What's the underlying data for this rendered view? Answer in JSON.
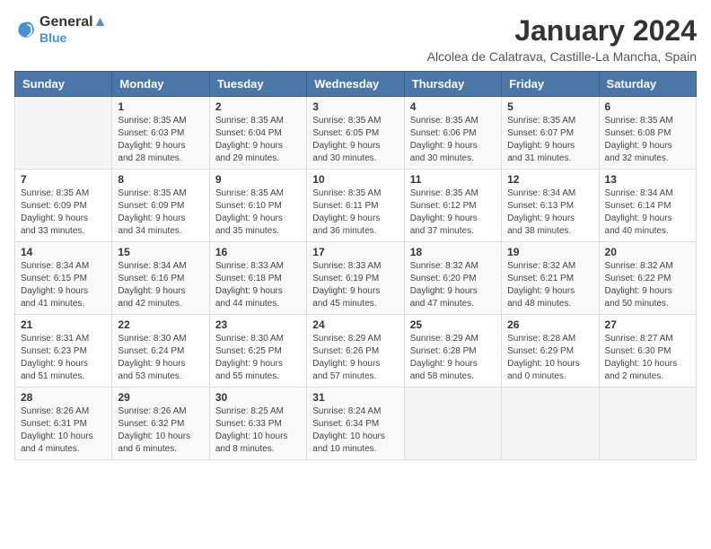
{
  "header": {
    "logo_line1": "General",
    "logo_line2": "Blue",
    "month": "January 2024",
    "location": "Alcolea de Calatrava, Castille-La Mancha, Spain"
  },
  "days_of_week": [
    "Sunday",
    "Monday",
    "Tuesday",
    "Wednesday",
    "Thursday",
    "Friday",
    "Saturday"
  ],
  "weeks": [
    [
      {
        "day": "",
        "info": ""
      },
      {
        "day": "1",
        "info": "Sunrise: 8:35 AM\nSunset: 6:03 PM\nDaylight: 9 hours\nand 28 minutes."
      },
      {
        "day": "2",
        "info": "Sunrise: 8:35 AM\nSunset: 6:04 PM\nDaylight: 9 hours\nand 29 minutes."
      },
      {
        "day": "3",
        "info": "Sunrise: 8:35 AM\nSunset: 6:05 PM\nDaylight: 9 hours\nand 30 minutes."
      },
      {
        "day": "4",
        "info": "Sunrise: 8:35 AM\nSunset: 6:06 PM\nDaylight: 9 hours\nand 30 minutes."
      },
      {
        "day": "5",
        "info": "Sunrise: 8:35 AM\nSunset: 6:07 PM\nDaylight: 9 hours\nand 31 minutes."
      },
      {
        "day": "6",
        "info": "Sunrise: 8:35 AM\nSunset: 6:08 PM\nDaylight: 9 hours\nand 32 minutes."
      }
    ],
    [
      {
        "day": "7",
        "info": "Sunrise: 8:35 AM\nSunset: 6:09 PM\nDaylight: 9 hours\nand 33 minutes."
      },
      {
        "day": "8",
        "info": "Sunrise: 8:35 AM\nSunset: 6:09 PM\nDaylight: 9 hours\nand 34 minutes."
      },
      {
        "day": "9",
        "info": "Sunrise: 8:35 AM\nSunset: 6:10 PM\nDaylight: 9 hours\nand 35 minutes."
      },
      {
        "day": "10",
        "info": "Sunrise: 8:35 AM\nSunset: 6:11 PM\nDaylight: 9 hours\nand 36 minutes."
      },
      {
        "day": "11",
        "info": "Sunrise: 8:35 AM\nSunset: 6:12 PM\nDaylight: 9 hours\nand 37 minutes."
      },
      {
        "day": "12",
        "info": "Sunrise: 8:34 AM\nSunset: 6:13 PM\nDaylight: 9 hours\nand 38 minutes."
      },
      {
        "day": "13",
        "info": "Sunrise: 8:34 AM\nSunset: 6:14 PM\nDaylight: 9 hours\nand 40 minutes."
      }
    ],
    [
      {
        "day": "14",
        "info": "Sunrise: 8:34 AM\nSunset: 6:15 PM\nDaylight: 9 hours\nand 41 minutes."
      },
      {
        "day": "15",
        "info": "Sunrise: 8:34 AM\nSunset: 6:16 PM\nDaylight: 9 hours\nand 42 minutes."
      },
      {
        "day": "16",
        "info": "Sunrise: 8:33 AM\nSunset: 6:18 PM\nDaylight: 9 hours\nand 44 minutes."
      },
      {
        "day": "17",
        "info": "Sunrise: 8:33 AM\nSunset: 6:19 PM\nDaylight: 9 hours\nand 45 minutes."
      },
      {
        "day": "18",
        "info": "Sunrise: 8:32 AM\nSunset: 6:20 PM\nDaylight: 9 hours\nand 47 minutes."
      },
      {
        "day": "19",
        "info": "Sunrise: 8:32 AM\nSunset: 6:21 PM\nDaylight: 9 hours\nand 48 minutes."
      },
      {
        "day": "20",
        "info": "Sunrise: 8:32 AM\nSunset: 6:22 PM\nDaylight: 9 hours\nand 50 minutes."
      }
    ],
    [
      {
        "day": "21",
        "info": "Sunrise: 8:31 AM\nSunset: 6:23 PM\nDaylight: 9 hours\nand 51 minutes."
      },
      {
        "day": "22",
        "info": "Sunrise: 8:30 AM\nSunset: 6:24 PM\nDaylight: 9 hours\nand 53 minutes."
      },
      {
        "day": "23",
        "info": "Sunrise: 8:30 AM\nSunset: 6:25 PM\nDaylight: 9 hours\nand 55 minutes."
      },
      {
        "day": "24",
        "info": "Sunrise: 8:29 AM\nSunset: 6:26 PM\nDaylight: 9 hours\nand 57 minutes."
      },
      {
        "day": "25",
        "info": "Sunrise: 8:29 AM\nSunset: 6:28 PM\nDaylight: 9 hours\nand 58 minutes."
      },
      {
        "day": "26",
        "info": "Sunrise: 8:28 AM\nSunset: 6:29 PM\nDaylight: 10 hours\nand 0 minutes."
      },
      {
        "day": "27",
        "info": "Sunrise: 8:27 AM\nSunset: 6:30 PM\nDaylight: 10 hours\nand 2 minutes."
      }
    ],
    [
      {
        "day": "28",
        "info": "Sunrise: 8:26 AM\nSunset: 6:31 PM\nDaylight: 10 hours\nand 4 minutes."
      },
      {
        "day": "29",
        "info": "Sunrise: 8:26 AM\nSunset: 6:32 PM\nDaylight: 10 hours\nand 6 minutes."
      },
      {
        "day": "30",
        "info": "Sunrise: 8:25 AM\nSunset: 6:33 PM\nDaylight: 10 hours\nand 8 minutes."
      },
      {
        "day": "31",
        "info": "Sunrise: 8:24 AM\nSunset: 6:34 PM\nDaylight: 10 hours\nand 10 minutes."
      },
      {
        "day": "",
        "info": ""
      },
      {
        "day": "",
        "info": ""
      },
      {
        "day": "",
        "info": ""
      }
    ]
  ]
}
